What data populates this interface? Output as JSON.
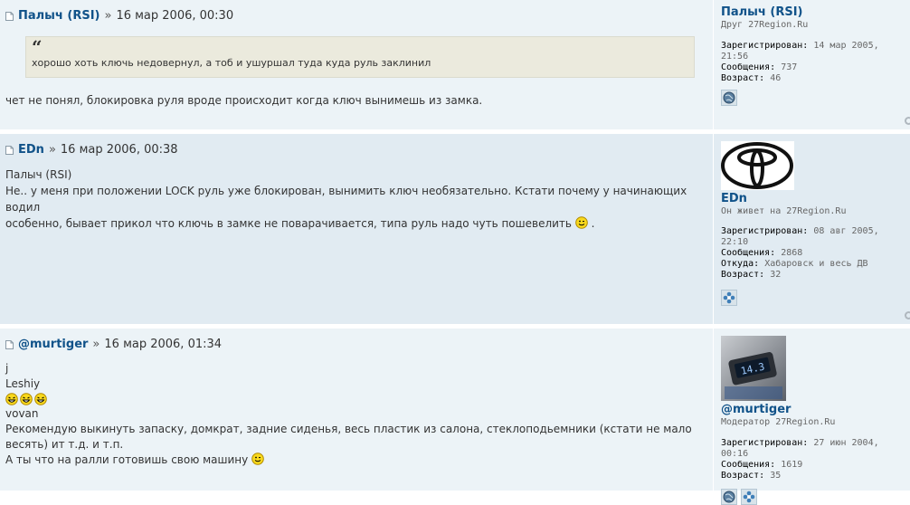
{
  "posts": [
    {
      "author": "Палыч (RSI)",
      "separator": "»",
      "date": "16 мар 2006, 00:30",
      "quote": "хорошо хоть ключь недовернул, а тоб и ушуршал туда куда руль заклинил",
      "quote_mark": "“",
      "lines": [
        "чет не понял, блокировка руля вроде происходит когда ключ вынимешь из замка."
      ],
      "profile": {
        "name": "Палыч (RSI)",
        "rank": "Друг 27Region.Ru",
        "registered_label": "Зарегистрирован:",
        "registered_value": "14 мар 2005,",
        "registered_time": "21:56",
        "messages_label": "Сообщения:",
        "messages_value": "737",
        "age_label": "Возраст:",
        "age_value": "46",
        "icons": [
          "globe-icon"
        ]
      }
    },
    {
      "author": "EDn",
      "separator": "»",
      "date": "16 мар 2006, 00:38",
      "lines": [
        "Палыч (RSI)",
        "Не.. у меня при положении LOCK руль уже блокирован, вынимить ключ необязательно. Кстати почему у начинающих водил",
        "особенно, бывает прикол что ключь в замке не поварачивается, типа руль надо чуть пошевелить",
        "."
      ],
      "profile": {
        "name": "EDn",
        "rank": "Он живет на 27Region.Ru",
        "registered_label": "Зарегистрирован:",
        "registered_value": "08 авг 2005,",
        "registered_time": "22:10",
        "messages_label": "Сообщения:",
        "messages_value": "2868",
        "from_label": "Откуда:",
        "from_value": "Хабаровск и весь ДВ",
        "age_label": "Возраст:",
        "age_value": "32",
        "icons": [
          "flower-icon"
        ]
      }
    },
    {
      "author": "@murtiger",
      "separator": "»",
      "date": "16 мар 2006, 01:34",
      "lines": [
        "j",
        "Leshiy",
        "vovan",
        "Рекомендую выкинуть запаску, домкрат, задние сиденья, весь пластик из салона, стеклоподьемники (кстати не мало",
        "весять) ит т.д. и т.п.",
        "А ты что на ралли готовишь свою машину"
      ],
      "profile": {
        "name": "@murtiger",
        "rank": "Модератор 27Region.Ru",
        "avatar_text": "14.3",
        "registered_label": "Зарегистрирован:",
        "registered_value": "27 июн 2004,",
        "registered_time": "00:16",
        "messages_label": "Сообщения:",
        "messages_value": "1619",
        "age_label": "Возраст:",
        "age_value": "35",
        "icons": [
          "globe-icon",
          "flower-icon"
        ]
      }
    }
  ],
  "colors": {
    "link": "#105289",
    "bg1": "#ecf3f7",
    "bg2": "#e1ebf2",
    "quote_bg": "#ebeadd"
  }
}
